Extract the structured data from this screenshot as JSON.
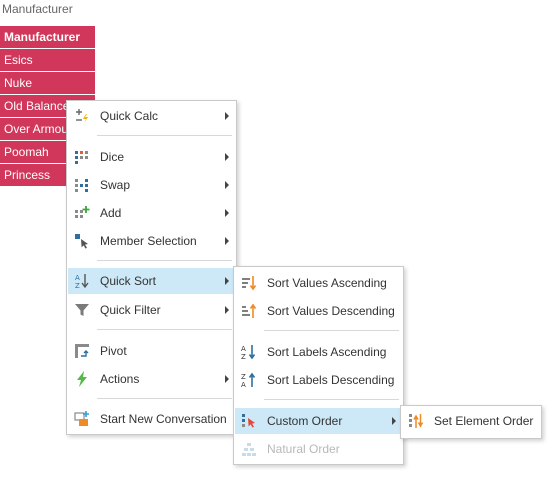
{
  "header": {
    "label": "Manufacturer"
  },
  "members": [
    {
      "label": "Manufacturer",
      "bold": true
    },
    {
      "label": "Esics",
      "bold": false
    },
    {
      "label": "Nuke",
      "bold": false
    },
    {
      "label": "Old Balance",
      "bold": false
    },
    {
      "label": "Over Armour",
      "bold": false
    },
    {
      "label": "Poomah",
      "bold": false
    },
    {
      "label": "Princess",
      "bold": false
    }
  ],
  "context_menu": {
    "items": [
      {
        "label": "Quick Calc",
        "icon": "quick-calc-icon",
        "submenu": true
      },
      {
        "label": "Dice",
        "icon": "dice-icon",
        "submenu": true
      },
      {
        "label": "Swap",
        "icon": "swap-icon",
        "submenu": true
      },
      {
        "label": "Add",
        "icon": "add-icon",
        "submenu": true
      },
      {
        "label": "Member Selection",
        "icon": "member-selection-icon",
        "submenu": true
      },
      {
        "label": "Quick Sort",
        "icon": "quick-sort-icon",
        "submenu": true,
        "highlighted": true
      },
      {
        "label": "Quick Filter",
        "icon": "filter-icon",
        "submenu": true
      },
      {
        "label": "Pivot",
        "icon": "pivot-icon",
        "submenu": false
      },
      {
        "label": "Actions",
        "icon": "lightning-icon",
        "submenu": true
      },
      {
        "label": "Start New Conversation",
        "icon": "conversation-icon",
        "submenu": false
      }
    ]
  },
  "sort_menu": {
    "items": [
      {
        "label": "Sort Values Ascending",
        "icon": "sort-values-ascending-icon"
      },
      {
        "label": "Sort Values Descending",
        "icon": "sort-values-descending-icon"
      },
      {
        "label": "Sort Labels Ascending",
        "icon": "sort-labels-ascending-icon"
      },
      {
        "label": "Sort Labels Descending",
        "icon": "sort-labels-descending-icon"
      },
      {
        "label": "Custom Order",
        "icon": "custom-order-icon",
        "submenu": true,
        "highlighted": true
      },
      {
        "label": "Natural Order",
        "icon": "natural-order-icon",
        "disabled": true
      }
    ]
  },
  "custom_order_menu": {
    "items": [
      {
        "label": "Set Element Order",
        "icon": "set-element-order-icon"
      }
    ]
  },
  "colors": {
    "member_bg": "#d0375a",
    "highlight_bg": "#cde8f7",
    "menu_border": "#c9c9c9",
    "accent_orange": "#f08a24",
    "accent_blue": "#2f6f9f"
  }
}
